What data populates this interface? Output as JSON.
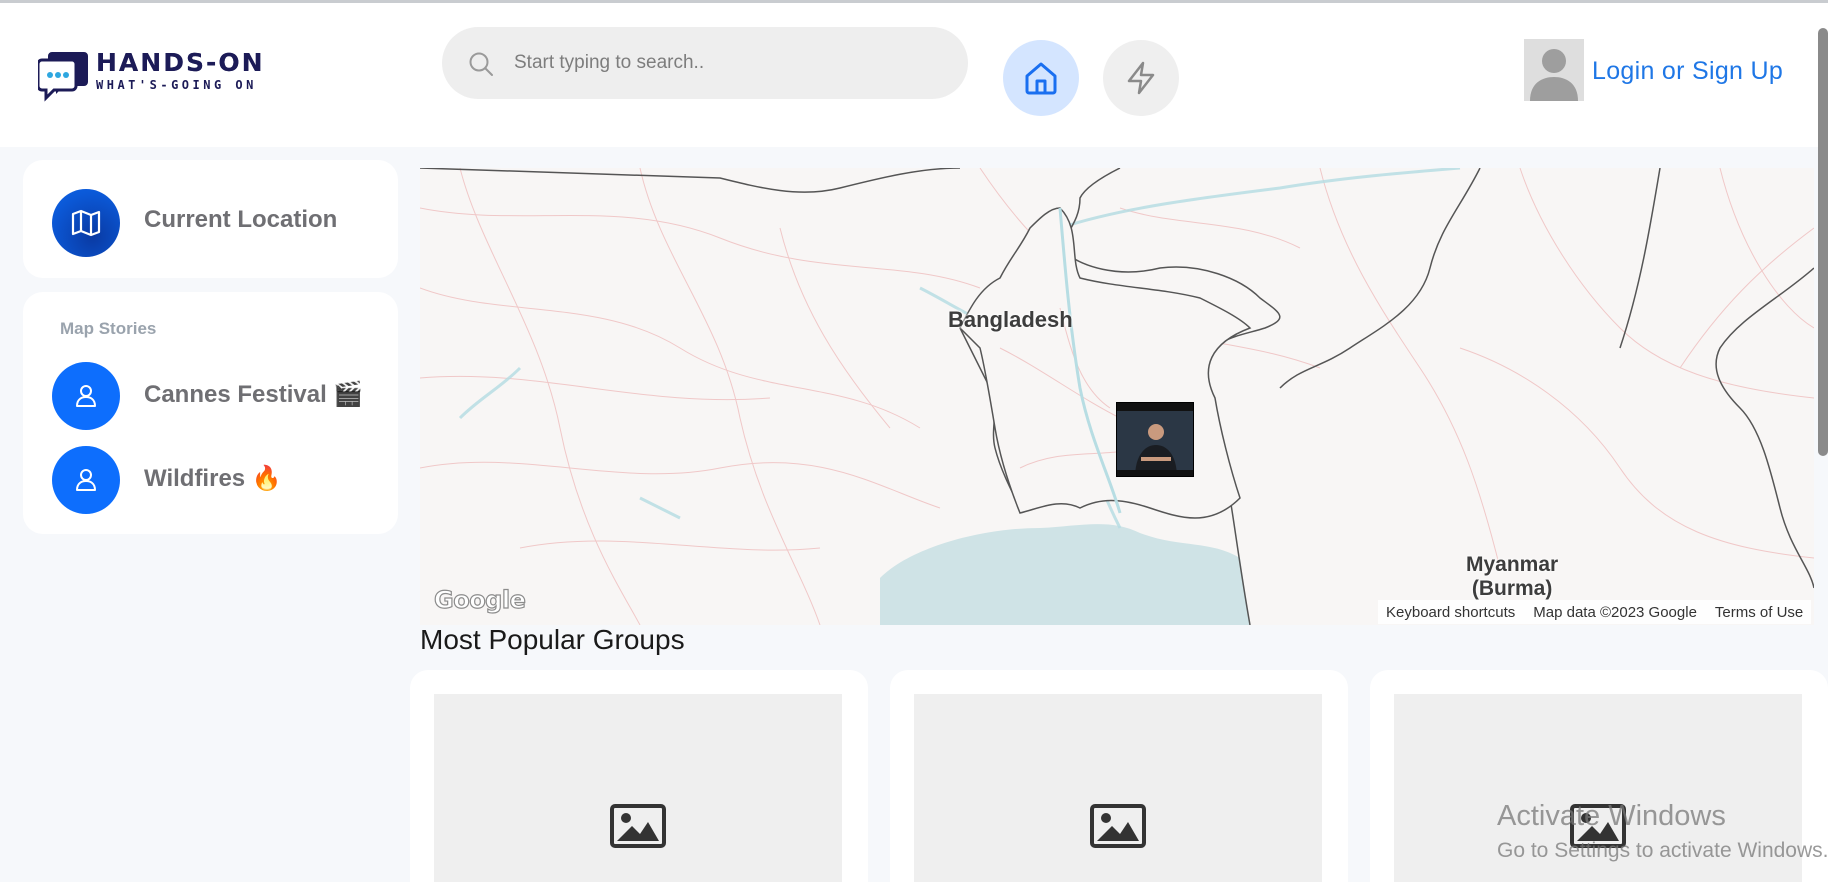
{
  "header": {
    "logo_main": "HANDS-ON",
    "logo_sub": "WHAT'S-GOING ON",
    "search_placeholder": "Start typing to search..",
    "login_label": "Login or Sign Up"
  },
  "sidebar": {
    "current_location_label": "Current Location",
    "stories_heading": "Map Stories",
    "stories": [
      {
        "label": "Cannes Festival 🎬",
        "icon": "user-icon"
      },
      {
        "label": "Wildfires 🔥",
        "icon": "user-icon"
      }
    ]
  },
  "map": {
    "labels": {
      "bangladesh": "Bangladesh",
      "myanmar_line1": "Myanmar",
      "myanmar_line2": "(Burma)"
    },
    "google_logo": "Google",
    "attribution": {
      "shortcuts": "Keyboard shortcuts",
      "data": "Map data ©2023 Google",
      "terms": "Terms of Use"
    }
  },
  "groups": {
    "title": "Most Popular Groups",
    "cards": [
      {
        "image_icon": "image-placeholder-icon"
      },
      {
        "image_icon": "image-placeholder-icon"
      },
      {
        "image_icon": "image-placeholder-icon"
      }
    ]
  },
  "watermark": {
    "title": "Activate Windows",
    "subtitle": "Go to Settings to activate Windows."
  },
  "colors": {
    "accent_blue": "#0d6efd",
    "link_blue": "#1f77e6",
    "logo_navy": "#1c1b57",
    "home_button_bg": "#d4e5ff"
  }
}
